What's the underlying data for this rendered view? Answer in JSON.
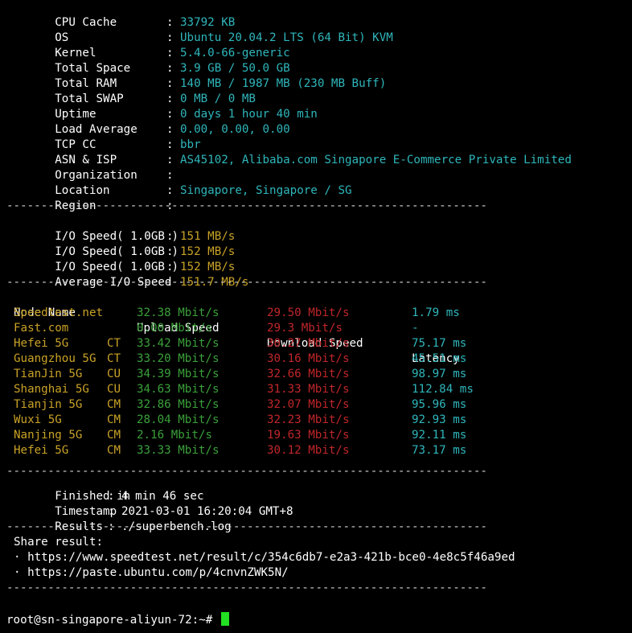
{
  "sysinfo": [
    {
      "key": "CPU Cache",
      "value": "33792 KB"
    },
    {
      "key": "OS",
      "value": "Ubuntu 20.04.2 LTS (64 Bit) KVM"
    },
    {
      "key": "Kernel",
      "value": "5.4.0-66-generic"
    },
    {
      "key": "Total Space",
      "value": "3.9 GB / 50.0 GB"
    },
    {
      "key": "Total RAM",
      "value": "140 MB / 1987 MB (230 MB Buff)"
    },
    {
      "key": "Total SWAP",
      "value": "0 MB / 0 MB"
    },
    {
      "key": "Uptime",
      "value": "0 days 1 hour 40 min"
    },
    {
      "key": "Load Average",
      "value": "0.00, 0.00, 0.00"
    },
    {
      "key": "TCP CC",
      "value": "bbr"
    },
    {
      "key": "ASN & ISP",
      "value": "AS45102, Alibaba.com Singapore E-Commerce Private Limited"
    },
    {
      "key": "Organization",
      "value": ""
    },
    {
      "key": "Location",
      "value": "Singapore, Singapore / SG"
    },
    {
      "key": "Region",
      "value": ""
    }
  ],
  "separator": "----------------------------------------------------------------------",
  "io": [
    {
      "key": "I/O Speed( 1.0GB )",
      "value": "151 MB/s"
    },
    {
      "key": "I/O Speed( 1.0GB )",
      "value": "152 MB/s"
    },
    {
      "key": "I/O Speed( 1.0GB )",
      "value": "152 MB/s"
    },
    {
      "key": "Average I/O Speed",
      "value": "151.7 MB/s"
    }
  ],
  "speed_table": {
    "headers": [
      "Node Name",
      "Upload Speed",
      "Download Speed",
      "Latency"
    ],
    "rows": [
      {
        "node": "Speedtest.net",
        "isp": "",
        "upload": "32.38 Mbit/s",
        "download": "29.50 Mbit/s",
        "latency": "1.79 ms"
      },
      {
        "node": "Fast.com",
        "isp": "",
        "upload": "0.00 Mbit/s",
        "download": "29.3 Mbit/s",
        "latency": "-"
      },
      {
        "node": "Hefei 5G",
        "isp": "CT",
        "upload": "33.42 Mbit/s",
        "download": "30.27 Mbit/s",
        "latency": "75.17 ms"
      },
      {
        "node": "Guangzhou 5G",
        "isp": "CT",
        "upload": "33.20 Mbit/s",
        "download": "30.16 Mbit/s",
        "latency": "45.51 ms"
      },
      {
        "node": "TianJin 5G",
        "isp": "CU",
        "upload": "34.39 Mbit/s",
        "download": "32.66 Mbit/s",
        "latency": "98.97 ms"
      },
      {
        "node": "Shanghai 5G",
        "isp": "CU",
        "upload": "34.63 Mbit/s",
        "download": "31.33 Mbit/s",
        "latency": "112.84 ms"
      },
      {
        "node": "Tianjin 5G",
        "isp": "CM",
        "upload": "32.86 Mbit/s",
        "download": "32.07 Mbit/s",
        "latency": "95.96 ms"
      },
      {
        "node": "Wuxi 5G",
        "isp": "CM",
        "upload": "28.04 Mbit/s",
        "download": "32.23 Mbit/s",
        "latency": "92.93 ms"
      },
      {
        "node": "Nanjing 5G",
        "isp": "CM",
        "upload": "2.16 Mbit/s",
        "download": "19.63 Mbit/s",
        "latency": "92.11 ms"
      },
      {
        "node": "Hefei 5G",
        "isp": "CM",
        "upload": "33.33 Mbit/s",
        "download": "30.12 Mbit/s",
        "latency": "73.17 ms"
      }
    ]
  },
  "summary": [
    {
      "key": "Finished in",
      "value": "4 min 46 sec"
    },
    {
      "key": "Timestamp",
      "value": "2021-03-01 16:20:04 GMT+8"
    },
    {
      "key": "Results",
      "value": "./superbench.log"
    }
  ],
  "share": {
    "title": "Share result:",
    "links": [
      "· https://www.speedtest.net/result/c/354c6db7-e2a3-421b-bce0-4e8c5f46a9ed",
      "· https://paste.ubuntu.com/p/4cnvnZWK5N/"
    ]
  },
  "prompt": "root@sn-singapore-aliyun-72:~#",
  "colors": {
    "background": "#000000",
    "label": "#ffffff",
    "value_cyan": "#2fb6bb",
    "node_yellow": "#c9a227",
    "upload_green": "#3aa03a",
    "download_red": "#c0262a",
    "cursor_green": "#22e022"
  }
}
